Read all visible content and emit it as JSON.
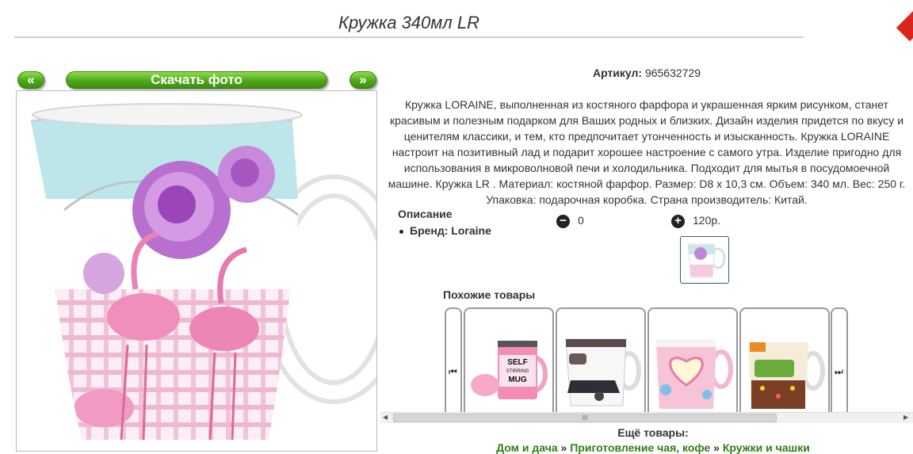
{
  "product": {
    "title": "Кружка 340мл LR",
    "article_label": "Артикул:",
    "article_value": "965632729",
    "description": "Кружка LORAINE, выполненная из костяного фарфора и украшенная ярким рисунком, станет красивым и полезным подарком для Ваших родных и близких. Дизайн изделия придется по вкусу и ценителям классики, и тем, кто предпочитает утонченность и изысканность. Кружка LORAINE настроит на позитивный лад и подарит хорошее настроение с самого утра. Изделие пригодно для использования в микроволновой печи и холодильника. Подходит для мытья в посудомоечной машине. Кружка LR . Материал: костяной фарфор. Размер: D8 x 10,3 см. Объем: 340 мл. Вес: 250 г. Упаковка: подарочная коробка. Страна производитель: Китай.",
    "opisanie_label": "Описание",
    "brand_label": "Бренд: Loraine"
  },
  "gallery": {
    "prev_label": "«",
    "download_label": "Скачать фото",
    "next_label": "»"
  },
  "quantity": {
    "minus_symbol": "−",
    "value": "0",
    "plus_symbol": "+",
    "price": "120р."
  },
  "similar": {
    "title": "Похожие товары",
    "left_arrow": "⏮",
    "right_arrow": "⏭",
    "cards": [
      {
        "name": "self-stirring-mug",
        "text_line1": "SELF",
        "text_line2": "STIRRING",
        "text_line3": "MUG"
      },
      {
        "name": "car-print-mug"
      },
      {
        "name": "heart-flower-mug"
      },
      {
        "name": "retro-car-mug"
      }
    ]
  },
  "scrollbar": {
    "left_arrow": "◀",
    "right_arrow": "▶",
    "grip": "III"
  },
  "more": {
    "label": "Ещё товары:",
    "crumbs": [
      "Дом и дача",
      "Приготовление чая, кофе",
      "Кружки и чашки"
    ],
    "separator": "»"
  },
  "colors": {
    "accent_green": "#4fa61a",
    "link_green": "#2f7d17",
    "close_red": "#d9251d"
  }
}
